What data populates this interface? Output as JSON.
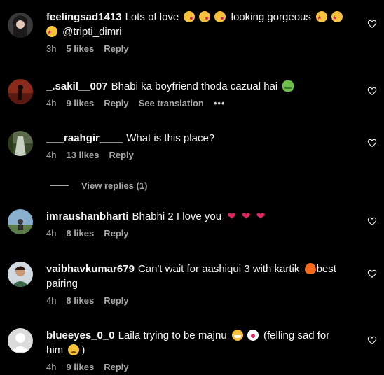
{
  "comments": [
    {
      "username": "feelingsad1413",
      "text_a": "Lots of love",
      "text_b": "looking gorgeous",
      "text_c": "@tripti_dimri",
      "time": "3h",
      "likes": "5 likes",
      "reply": "Reply"
    },
    {
      "username": "_.sakil__007",
      "text": "Bhabi ka boyfriend thoda cazual hai",
      "time": "4h",
      "likes": "9 likes",
      "reply": "Reply",
      "see_translation": "See translation",
      "more": "•••"
    },
    {
      "username": "___raahgir____",
      "text": "What is this place?",
      "time": "4h",
      "likes": "13 likes",
      "reply": "Reply"
    },
    {
      "username": "imraushanbharti",
      "text": "Bhabhi 2 I love you",
      "time": "4h",
      "likes": "8 likes",
      "reply": "Reply"
    },
    {
      "username": "vaibhavkumar679",
      "text_a": "Can't wait for aashiqui 3 with kartik",
      "text_b": "best",
      "text_c": "pairing",
      "time": "4h",
      "likes": "8 likes",
      "reply": "Reply"
    },
    {
      "username": "blueeyes_0_0",
      "text_a": "Laila trying to be majnu",
      "text_b": "(felling sad for",
      "text_c": "him",
      "text_d": ")",
      "time": "4h",
      "likes": "9 likes",
      "reply": "Reply"
    }
  ],
  "view_replies": "View replies (1)",
  "icons": {
    "heart": "heart-outline-icon",
    "emoji_kiss": "face-blowing-kiss",
    "emoji_star": "star-struck",
    "emoji_frog": "frog",
    "emoji_fire": "fire",
    "emoji_heart": "red-heart",
    "emoji_grin": "grinning-squinting-face",
    "emoji_clown": "clown-face",
    "emoji_sad": "sad-face"
  }
}
